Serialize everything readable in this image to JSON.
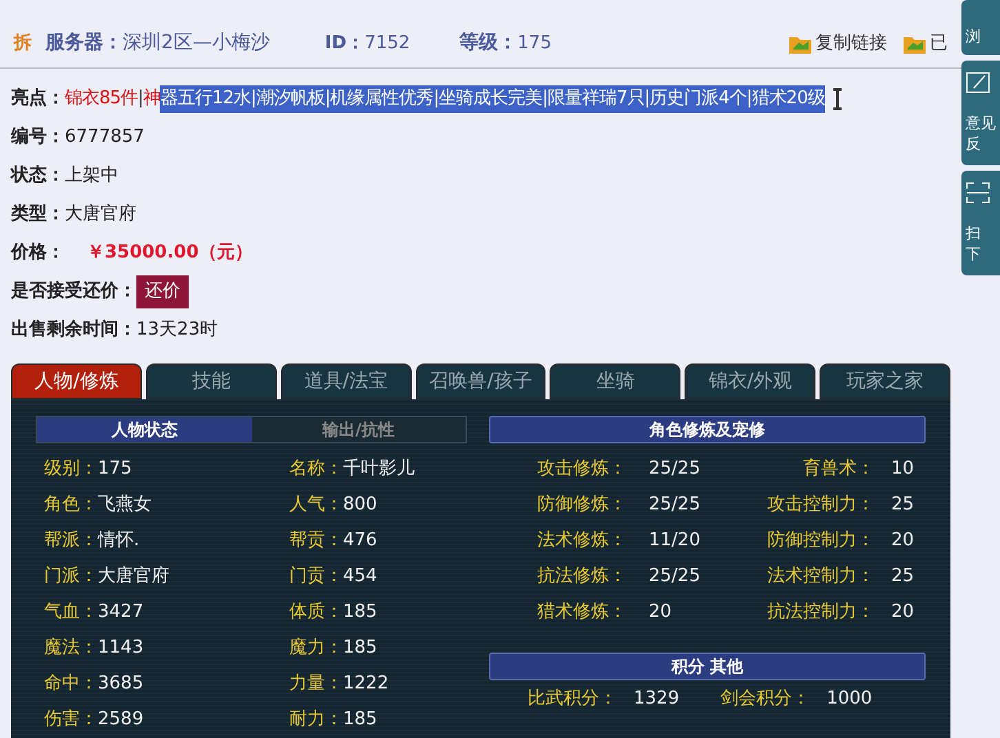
{
  "header": {
    "badge": "拆",
    "server_label": "服务器：",
    "server": "深圳2区—小梅沙",
    "id_label": "ID：",
    "id": "7152",
    "level_label": "等级：",
    "level": "175",
    "actions": [
      {
        "label": "复制链接"
      },
      {
        "label": "已"
      }
    ]
  },
  "highlights": {
    "label": "亮点：",
    "segments": [
      {
        "text": "锦衣85件",
        "selected": false,
        "kind": "accent"
      },
      {
        "text": "|",
        "selected": false,
        "kind": "plain"
      },
      {
        "text": "神",
        "selected": false,
        "kind": "accent"
      },
      {
        "text": "器五行12水|潮汐帆板|机缘属性优秀|坐骑成长完美|限量祥瑞7只|历史门派4个|猎术20级",
        "selected": true
      }
    ]
  },
  "fields": [
    {
      "kind": "text",
      "label": "编号：",
      "value": "6777857"
    },
    {
      "kind": "text",
      "label": "状态：",
      "value": "上架中"
    },
    {
      "kind": "text",
      "label": "类型：",
      "value": "大唐官府"
    },
    {
      "kind": "price",
      "label": "价格：",
      "value": "￥35000.00（元）"
    },
    {
      "kind": "button",
      "label": "是否接受还价：",
      "value": "还价"
    },
    {
      "kind": "text",
      "label": "出售剩余时间：",
      "value": "13天23时"
    }
  ],
  "tabs": [
    {
      "label": "人物/修炼",
      "selected": true
    },
    {
      "label": "技能",
      "selected": false
    },
    {
      "label": "道具/法宝",
      "selected": false
    },
    {
      "label": "召唤兽/孩子",
      "selected": false
    },
    {
      "label": "坐骑",
      "selected": false
    },
    {
      "label": "锦衣/外观",
      "selected": false
    },
    {
      "label": "玩家之家",
      "selected": false
    }
  ],
  "character": {
    "subtabs": [
      {
        "label": "人物状态",
        "selected": true
      },
      {
        "label": "输出/抗性",
        "selected": false
      }
    ],
    "stats": [
      [
        {
          "label": "级别：",
          "value": "175"
        },
        {
          "label": "名称：",
          "value": "千叶影儿"
        }
      ],
      [
        {
          "label": "角色：",
          "value": "飞燕女"
        },
        {
          "label": "人气：",
          "value": "800"
        }
      ],
      [
        {
          "label": "帮派：",
          "value": "情怀."
        },
        {
          "label": "帮贡：",
          "value": "476"
        }
      ],
      [
        {
          "label": "门派：",
          "value": "大唐官府"
        },
        {
          "label": "门贡：",
          "value": "454"
        }
      ],
      [
        {
          "label": "气血：",
          "value": "3427"
        },
        {
          "label": "体质：",
          "value": "185"
        }
      ],
      [
        {
          "label": "魔法：",
          "value": "1143"
        },
        {
          "label": "魔力：",
          "value": "185"
        }
      ],
      [
        {
          "label": "命中：",
          "value": "3685"
        },
        {
          "label": "力量：",
          "value": "1222"
        }
      ],
      [
        {
          "label": "伤害：",
          "value": "2589"
        },
        {
          "label": "耐力：",
          "value": "185"
        }
      ]
    ]
  },
  "cultivation": {
    "title": "角色修炼及宠修",
    "rows": [
      [
        {
          "label": "攻击修炼：",
          "value": "25/25"
        },
        {
          "label": "育兽术：",
          "value": "10"
        }
      ],
      [
        {
          "label": "防御修炼：",
          "value": "25/25"
        },
        {
          "label": "攻击控制力：",
          "value": "25"
        }
      ],
      [
        {
          "label": "法术修炼：",
          "value": "11/20"
        },
        {
          "label": "防御控制力：",
          "value": "20"
        }
      ],
      [
        {
          "label": "抗法修炼：",
          "value": "25/25"
        },
        {
          "label": "法术控制力：",
          "value": "25"
        }
      ],
      [
        {
          "label": "猎术修炼：",
          "value": "20"
        },
        {
          "label": "抗法控制力：",
          "value": "20"
        }
      ]
    ]
  },
  "scores": {
    "title": "积分 其他",
    "items": [
      {
        "label": "比武积分：",
        "value": "1329"
      },
      {
        "label": "剑会积分：",
        "value": "1000"
      }
    ]
  },
  "side_panel": [
    {
      "lines": [
        "浏"
      ]
    },
    {
      "lines": [
        "意见",
        "反"
      ]
    },
    {
      "lines": [
        "扫",
        "下"
      ]
    }
  ]
}
